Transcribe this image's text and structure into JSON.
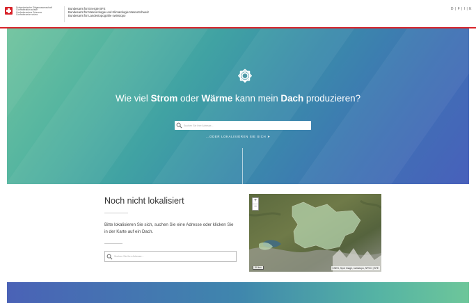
{
  "header": {
    "confederation": [
      "Schweizerische Eidgenossenschaft",
      "Confédération suisse",
      "Confederazione Svizzera",
      "Confederaziun svizra"
    ],
    "offices": [
      "Bundesamt für Energie BFE",
      "Bundesamt für Meteorologie und Klimatologie MeteoSchweiz",
      "Bundesamt für Landestopografie swisstopo"
    ],
    "languages": "D | F | I | E"
  },
  "hero": {
    "icon": "sun-icon",
    "headline": {
      "p1": "Wie viel ",
      "b1": "Strom",
      "p2": " oder ",
      "b2": "Wärme",
      "p3": " kann mein ",
      "b3": "Dach",
      "p4": " produzieren?"
    },
    "search_placeholder": "Suchen Sie Ihre Adresse...",
    "locate_label": "...ODER LOKALISIEREN SIE SICH ➤"
  },
  "not_located": {
    "title": "Noch nicht lokalisiert",
    "text": "Bitte lokalisieren Sie sich, suchen Sie eine Adresse oder klicken Sie in der Karte auf ein Dach.",
    "search_placeholder": "Suchen Sie Ihre Adresse..."
  },
  "map": {
    "zoom_in": "+",
    "zoom_out": "−",
    "scale": "30 km",
    "attribution": "CNES, Spot Image, swisstopo, NPOC | BFE"
  },
  "colors": {
    "swiss_red": "#d8232a",
    "hero_start": "#6fc39e",
    "hero_end": "#4860bb"
  }
}
